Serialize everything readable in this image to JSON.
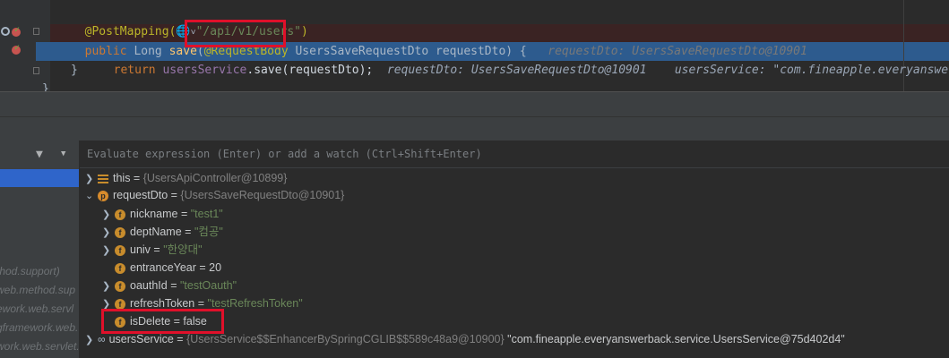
{
  "editor": {
    "line1": {
      "annotation": "@PostMapping(",
      "icon": "globe-icon",
      "chev": "˅",
      "path": "\"/api/v1/users\"",
      "close": ")"
    },
    "line2": {
      "kw_public": "public ",
      "type_long": "Long ",
      "method": "save",
      "open": "(",
      "annotation": "@RequestBody",
      "params": " UsersSaveRequestDto requestDto) {",
      "hint": "requestDto: UsersSaveRequestDto@10901"
    },
    "line3": {
      "kw_return": "return ",
      "field": "usersService",
      "call": ".save(requestDto);",
      "hint1": "requestDto: UsersSaveRequestDto@10901",
      "hint2": "usersService: \"com.fineapple.everyanswerb"
    },
    "line4": {
      "brace": "}"
    },
    "line5": {
      "brace": "}"
    }
  },
  "debugger": {
    "eval_placeholder": "Evaluate expression (Enter) or add a watch (Ctrl+Shift+Enter)",
    "frames": [
      "thod.support)",
      "web.method.sup",
      "ework.web.servl",
      "gframework.web.",
      "work.web.servlet.r"
    ],
    "variables": [
      {
        "name": "this",
        "eq": " = ",
        "obj": "{UsersApiController@10899}",
        "icon": "list-icon"
      },
      {
        "name": "requestDto",
        "eq": " = ",
        "obj": "{UsersSaveRequestDto@10901}",
        "icon": "parameter-icon"
      },
      {
        "name": "nickname",
        "eq": " = ",
        "str": "\"test1\"",
        "icon": "field-icon"
      },
      {
        "name": "deptName",
        "eq": " = ",
        "str": "\"컴공\"",
        "icon": "field-icon"
      },
      {
        "name": "univ",
        "eq": " = ",
        "str": "\"한양대\"",
        "icon": "field-icon"
      },
      {
        "name": "entranceYear",
        "eq": " = ",
        "val": "20",
        "icon": "field-icon"
      },
      {
        "name": "oauthId",
        "eq": " = ",
        "str": "\"testOauth\"",
        "icon": "field-icon"
      },
      {
        "name": "refreshToken",
        "eq": " = ",
        "str": "\"testRefreshToken\"",
        "icon": "field-icon"
      },
      {
        "name": "isDelete",
        "eq": " = ",
        "val": "false",
        "icon": "field-icon"
      },
      {
        "name": "usersService",
        "eq": " = ",
        "obj": "{UsersService$$EnhancerBySpringCGLIB$$589c48a9@10900}",
        "str": "\"com.fineapple.everyanswerback.service.UsersService@75d402d4\"",
        "icon": "watch-icon"
      }
    ]
  }
}
